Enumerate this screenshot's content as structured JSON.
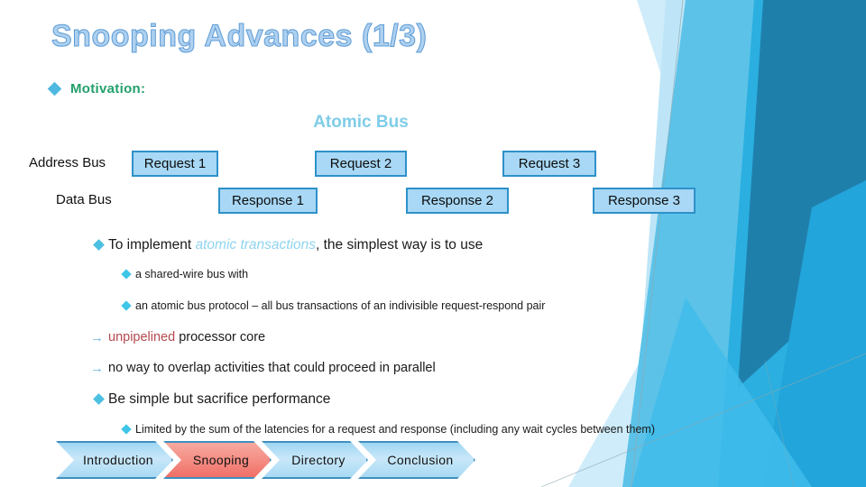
{
  "slide": {
    "title": "Snooping Advances (1/3)",
    "title_color": "#aed0ef",
    "title_outline_color": "#5b9bd5"
  },
  "motivation": {
    "bullet_icon": "diamond-bullet",
    "label": "Motivation:",
    "color": "#22a06b"
  },
  "diagram": {
    "title": "Atomic Bus",
    "title_color": "#7fcde8",
    "rows": [
      {
        "label": "Address Bus"
      },
      {
        "label": "Data Bus"
      }
    ],
    "box_fill": "#a8d8f5",
    "box_border": "#2e91c9",
    "address_boxes": [
      {
        "label": "Request 1"
      },
      {
        "label": "Request 2"
      },
      {
        "label": "Request 3"
      }
    ],
    "data_boxes": [
      {
        "label": "Response 1"
      },
      {
        "label": "Response 2"
      },
      {
        "label": "Response 3"
      }
    ]
  },
  "body": {
    "b1_pre": "To implement ",
    "b1_hl": "atomic transactions",
    "b1_post": ", the simplest way is to use",
    "b1_sub1": "a shared-wire bus with",
    "b1_sub2": "an atomic bus protocol – all bus transactions of an indivisible request-respond pair",
    "arrow_glyph": "→",
    "a1_hl": "unpipelined",
    "a1_post": " processor core",
    "a2": "no way to overlap activities that could proceed in parallel",
    "b2": "Be simple but sacrifice performance",
    "b2_sub1": "Limited by the sum of the latencies for a request and response (including any wait cycles between them)",
    "highlight_atomic_color": "#8fd4ef",
    "highlight_unpipelined_color": "#b5494f"
  },
  "nav": {
    "items": [
      {
        "label": "Introduction",
        "state": "inactive"
      },
      {
        "label": "Snooping",
        "state": "active"
      },
      {
        "label": "Directory",
        "state": "inactive"
      },
      {
        "label": "Conclusion",
        "state": "inactive"
      }
    ],
    "active_color": "#ef6f68",
    "inactive_color": "#a9daf3"
  }
}
